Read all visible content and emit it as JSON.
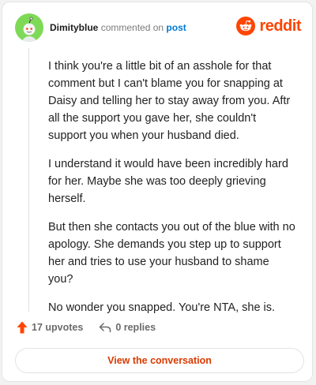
{
  "comment": {
    "username": "Dimityblue",
    "action_text": "commented on",
    "post_link_text": "post",
    "paragraphs": [
      "I think you're a little bit of an asshole for that comment but I can't blame you for snapping at Daisy and telling her to stay away from you. Aftr all the support you gave her, she couldn't support you when your husband died.",
      "I understand it would have been incredibly hard for her. Maybe she was too deeply grieving herself.",
      "But then she contacts you out of the blue with no apology. She demands you step up to support her and tries to use your husband to shame you?",
      "No wonder you snapped. You're NTA, she is."
    ],
    "upvotes_label": "17 upvotes",
    "replies_label": "0 replies",
    "cta_label": "View the conversation"
  },
  "brand": {
    "name": "reddit",
    "icon": "reddit-logo-icon"
  },
  "icons": {
    "avatar": "snoo-avatar-icon",
    "upvote": "upvote-arrow-icon",
    "reply": "reply-arrow-icon"
  },
  "colors": {
    "brand": "#ff4500",
    "avatar_background": "#7ed957",
    "link": "#0079d3",
    "cta_text": "#d93a00"
  }
}
